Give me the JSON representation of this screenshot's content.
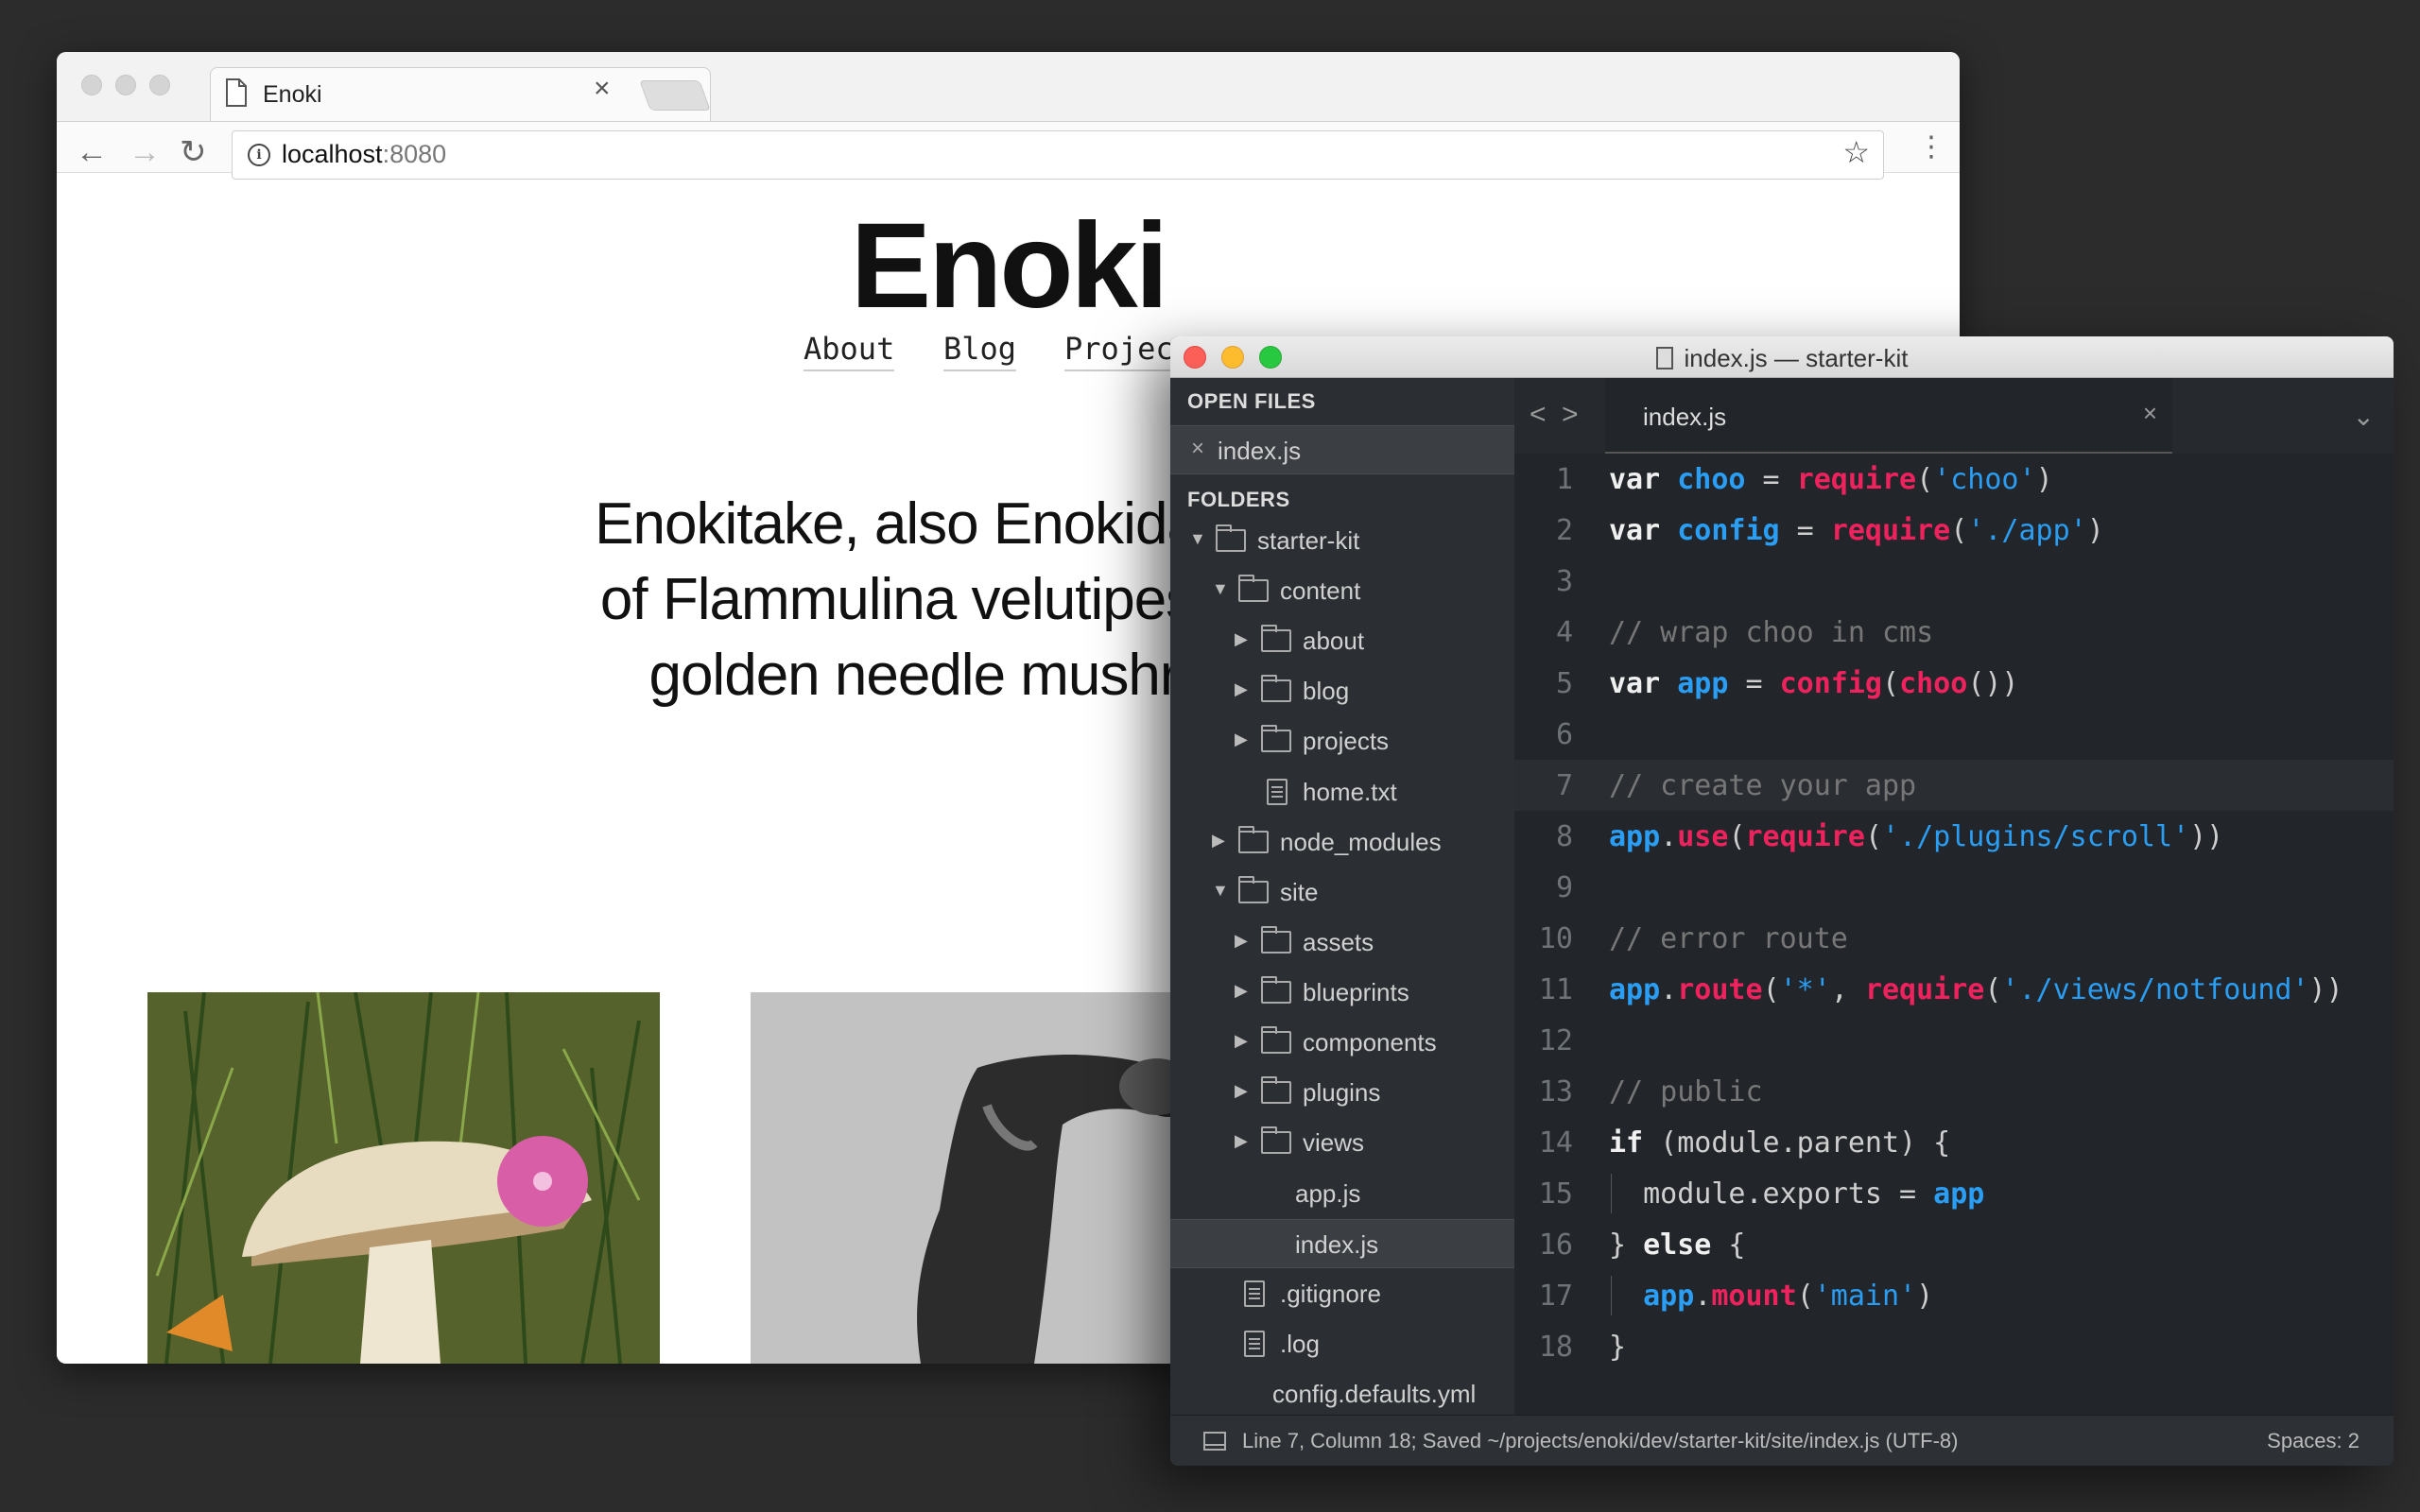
{
  "browser": {
    "tab_title": "Enoki",
    "tab_close": "×",
    "url_host": "localhost",
    "url_port": ":8080",
    "back": "←",
    "forward": "→",
    "reload": "↻",
    "star": "☆",
    "menu": "⋮"
  },
  "site": {
    "title": "Enoki",
    "nav": [
      "About",
      "Blog",
      "Projec"
    ],
    "intro_lines": [
      "Enokitake, also Enokidake or En",
      "of Flammulina velutipes, also kn",
      "golden needle mushroom or"
    ]
  },
  "editor": {
    "window_title": "index.js — starter-kit",
    "open_files_heading": "OPEN FILES",
    "folders_heading": "FOLDERS",
    "open_file": "index.js",
    "open_file_close": "×",
    "tree": [
      {
        "label": "starter-kit",
        "type": "folder",
        "level": 0,
        "arrow": "▼"
      },
      {
        "label": "content",
        "type": "folder",
        "level": 1,
        "arrow": "▼"
      },
      {
        "label": "about",
        "type": "folder",
        "level": 2,
        "arrow": "▶"
      },
      {
        "label": "blog",
        "type": "folder",
        "level": 2,
        "arrow": "▶"
      },
      {
        "label": "projects",
        "type": "folder",
        "level": 2,
        "arrow": "▶"
      },
      {
        "label": "home.txt",
        "type": "file",
        "level": 2,
        "arrow": ""
      },
      {
        "label": "node_modules",
        "type": "folder",
        "level": 1,
        "arrow": "▶"
      },
      {
        "label": "site",
        "type": "folder",
        "level": 1,
        "arrow": "▼"
      },
      {
        "label": "assets",
        "type": "folder",
        "level": 2,
        "arrow": "▶"
      },
      {
        "label": "blueprints",
        "type": "folder",
        "level": 2,
        "arrow": "▶"
      },
      {
        "label": "components",
        "type": "folder",
        "level": 2,
        "arrow": "▶"
      },
      {
        "label": "plugins",
        "type": "folder",
        "level": 2,
        "arrow": "▶"
      },
      {
        "label": "views",
        "type": "folder",
        "level": 2,
        "arrow": "▶"
      },
      {
        "label": "app.js",
        "type": "plain",
        "level": 2,
        "arrow": ""
      },
      {
        "label": "index.js",
        "type": "plain",
        "level": 2,
        "arrow": "",
        "selected": true
      },
      {
        "label": ".gitignore",
        "type": "file",
        "level": 1,
        "arrow": ""
      },
      {
        "label": ".log",
        "type": "file",
        "level": 1,
        "arrow": ""
      },
      {
        "label": "config.defaults.yml",
        "type": "plain",
        "level": 1,
        "arrow": ""
      }
    ],
    "tab_label": "index.js",
    "tab_close": "×",
    "nav_left": "<",
    "nav_right": ">",
    "tab_menu": "⌄",
    "active_line": 7,
    "code_lines": [
      [
        [
          "kw",
          "var "
        ],
        [
          "var",
          "choo"
        ],
        [
          "pn",
          " = "
        ],
        [
          "fn",
          "require"
        ],
        [
          "pn",
          "("
        ],
        [
          "str",
          "'choo'"
        ],
        [
          "pn",
          ")"
        ]
      ],
      [
        [
          "kw",
          "var "
        ],
        [
          "var",
          "config"
        ],
        [
          "pn",
          " = "
        ],
        [
          "fn",
          "require"
        ],
        [
          "pn",
          "("
        ],
        [
          "str",
          "'./app'"
        ],
        [
          "pn",
          ")"
        ]
      ],
      [],
      [
        [
          "com",
          "// wrap choo in cms"
        ]
      ],
      [
        [
          "kw",
          "var "
        ],
        [
          "var",
          "app"
        ],
        [
          "pn",
          " = "
        ],
        [
          "fn",
          "config"
        ],
        [
          "pn",
          "("
        ],
        [
          "fn",
          "choo"
        ],
        [
          "pn",
          "())"
        ]
      ],
      [],
      [
        [
          "com",
          "// create your app"
        ]
      ],
      [
        [
          "var",
          "app"
        ],
        [
          "pn",
          "."
        ],
        [
          "fn",
          "use"
        ],
        [
          "pn",
          "("
        ],
        [
          "fn",
          "require"
        ],
        [
          "pn",
          "("
        ],
        [
          "str",
          "'./plugins/scroll'"
        ],
        [
          "pn",
          "))"
        ]
      ],
      [],
      [
        [
          "com",
          "// error route"
        ]
      ],
      [
        [
          "var",
          "app"
        ],
        [
          "pn",
          "."
        ],
        [
          "fn",
          "route"
        ],
        [
          "pn",
          "("
        ],
        [
          "str",
          "'*'"
        ],
        [
          "pn",
          ", "
        ],
        [
          "fn",
          "require"
        ],
        [
          "pn",
          "("
        ],
        [
          "str",
          "'./views/notfound'"
        ],
        [
          "pn",
          "))"
        ]
      ],
      [],
      [
        [
          "com",
          "// public"
        ]
      ],
      [
        [
          "kw",
          "if"
        ],
        [
          "pn",
          " (module.parent) {"
        ]
      ],
      [
        [
          "pn",
          "  module.exports = "
        ],
        [
          "var",
          "app"
        ]
      ],
      [
        [
          "pn",
          "} "
        ],
        [
          "kw",
          "else"
        ],
        [
          "pn",
          " {"
        ]
      ],
      [
        [
          "pn",
          "  "
        ],
        [
          "var",
          "app"
        ],
        [
          "pn",
          "."
        ],
        [
          "fn",
          "mount"
        ],
        [
          "pn",
          "("
        ],
        [
          "str",
          "'main'"
        ],
        [
          "pn",
          ")"
        ]
      ],
      [
        [
          "pn",
          "}"
        ]
      ]
    ],
    "status_text": "Line 7, Column 18; Saved ~/projects/enoki/dev/starter-kit/site/index.js (UTF-8)",
    "status_right": "Spaces: 2"
  }
}
